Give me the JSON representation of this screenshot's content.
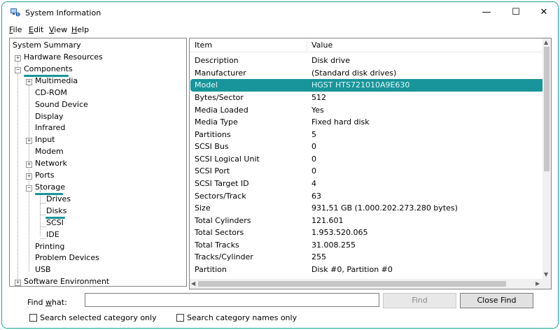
{
  "window": {
    "title": "System Information",
    "minimize": "—",
    "maximize": "☐",
    "close": "✕"
  },
  "menu": {
    "file": {
      "accel": "F",
      "rest": "ile"
    },
    "edit": {
      "accel": "E",
      "rest": "dit"
    },
    "view": {
      "accel": "V",
      "rest": "iew"
    },
    "help": {
      "accel": "H",
      "rest": "elp"
    }
  },
  "tree": {
    "system_summary": "System Summary",
    "hardware_resources": "Hardware Resources",
    "components": "Components",
    "multimedia": "Multimedia",
    "cd_rom": "CD-ROM",
    "sound_device": "Sound Device",
    "display": "Display",
    "infrared": "Infrared",
    "input": "Input",
    "modem": "Modem",
    "network": "Network",
    "ports": "Ports",
    "storage": "Storage",
    "drives": "Drives",
    "disks": "Disks",
    "scsi": "SCSI",
    "ide": "IDE",
    "printing": "Printing",
    "problem_devices": "Problem Devices",
    "usb": "USB",
    "software_environment": "Software Environment"
  },
  "list": {
    "col_item": "Item",
    "col_value": "Value",
    "rows": [
      {
        "item": "Description",
        "value": "Disk drive"
      },
      {
        "item": "Manufacturer",
        "value": "(Standard disk drives)"
      },
      {
        "item": "Model",
        "value": "HGST HTS721010A9E630"
      },
      {
        "item": "Bytes/Sector",
        "value": "512"
      },
      {
        "item": "Media Loaded",
        "value": "Yes"
      },
      {
        "item": "Media Type",
        "value": "Fixed hard disk"
      },
      {
        "item": "Partitions",
        "value": "5"
      },
      {
        "item": "SCSI Bus",
        "value": "0"
      },
      {
        "item": "SCSI Logical Unit",
        "value": "0"
      },
      {
        "item": "SCSI Port",
        "value": "0"
      },
      {
        "item": "SCSI Target ID",
        "value": "4"
      },
      {
        "item": "Sectors/Track",
        "value": "63"
      },
      {
        "item": "Size",
        "value": "931,51 GB (1.000.202.273.280 bytes)"
      },
      {
        "item": "Total Cylinders",
        "value": "121.601"
      },
      {
        "item": "Total Sectors",
        "value": "1.953.520.065"
      },
      {
        "item": "Total Tracks",
        "value": "31.008.255"
      },
      {
        "item": "Tracks/Cylinder",
        "value": "255"
      },
      {
        "item": "Partition",
        "value": "Disk #0, Partition #0"
      }
    ]
  },
  "find": {
    "label_accel": "w",
    "label_pre": "Find ",
    "label_post": "hat:",
    "input_value": "",
    "find_button": "Find",
    "close_button": "Close Find",
    "search_selected": "Search selected category only",
    "search_names": "Search category names only"
  },
  "colors": {
    "accent": "#17959a"
  }
}
